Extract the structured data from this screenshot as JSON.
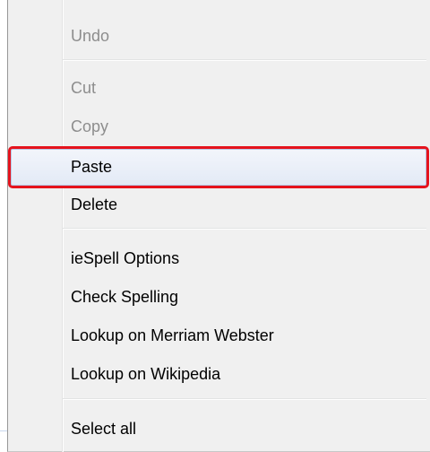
{
  "context_menu": {
    "items": [
      {
        "label": "Undo",
        "enabled": false
      },
      {
        "label": "Cut",
        "enabled": false
      },
      {
        "label": "Copy",
        "enabled": false
      },
      {
        "label": "Paste",
        "enabled": true,
        "highlighted": true
      },
      {
        "label": "Delete",
        "enabled": true
      },
      {
        "label": "ieSpell Options",
        "enabled": true
      },
      {
        "label": "Check Spelling",
        "enabled": true
      },
      {
        "label": "Lookup on Merriam Webster",
        "enabled": true
      },
      {
        "label": "Lookup on Wikipedia",
        "enabled": true
      },
      {
        "label": "Select all",
        "enabled": true
      }
    ]
  },
  "colors": {
    "menu_background": "#f0f0f0",
    "disabled_text": "#8d8d8d",
    "highlight_outline": "#e5131d"
  }
}
